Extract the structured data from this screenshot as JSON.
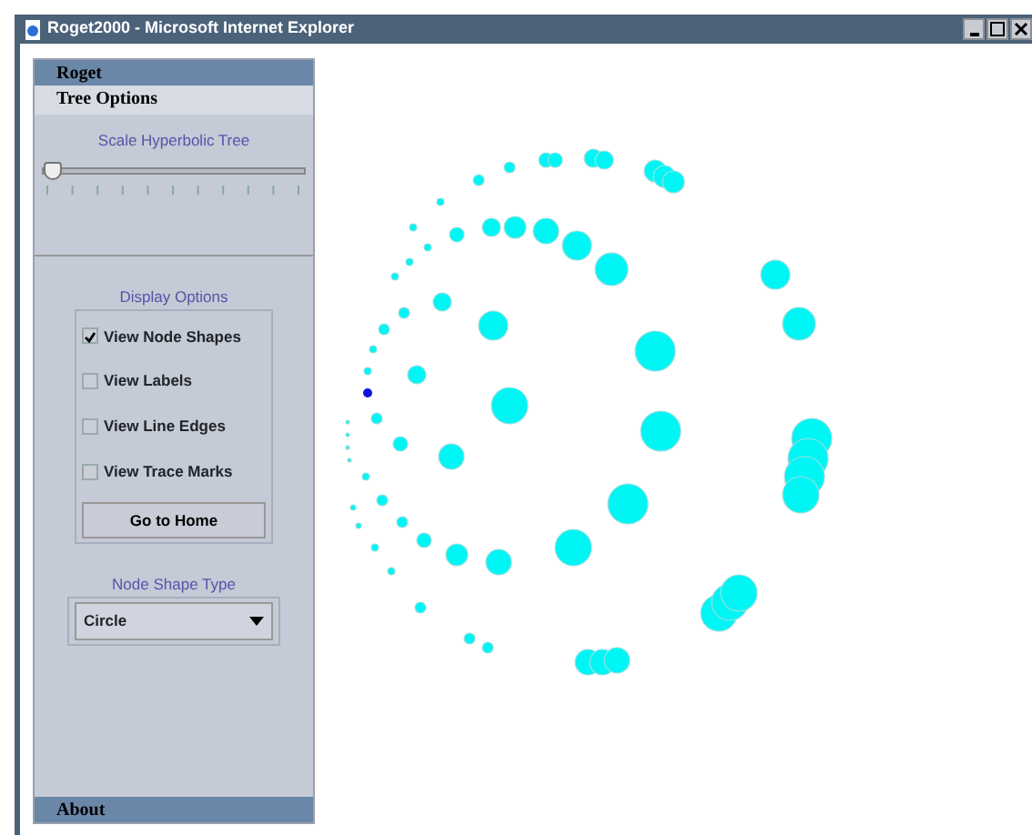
{
  "window": {
    "title": "Roget2000 - Microsoft Internet Explorer"
  },
  "tabs_top": [
    {
      "label": "Roget",
      "selected": false
    },
    {
      "label": "Tree Options",
      "selected": true
    }
  ],
  "scale_slider": {
    "label": "Scale Hyperbolic Tree",
    "level": 0
  },
  "display_options": {
    "title": "Display Options",
    "options": [
      {
        "label": "View Node Shapes",
        "checked": true
      },
      {
        "label": "View Labels",
        "checked": false
      },
      {
        "label": "View Line Edges",
        "checked": false
      },
      {
        "label": "View Trace Marks",
        "checked": false
      }
    ],
    "button": "Go to Home"
  },
  "node_shape_type": {
    "title": "Node Shape Type",
    "value": "Circle"
  },
  "tabs_bottom": [
    {
      "label": "About",
      "selected": false
    }
  ]
}
